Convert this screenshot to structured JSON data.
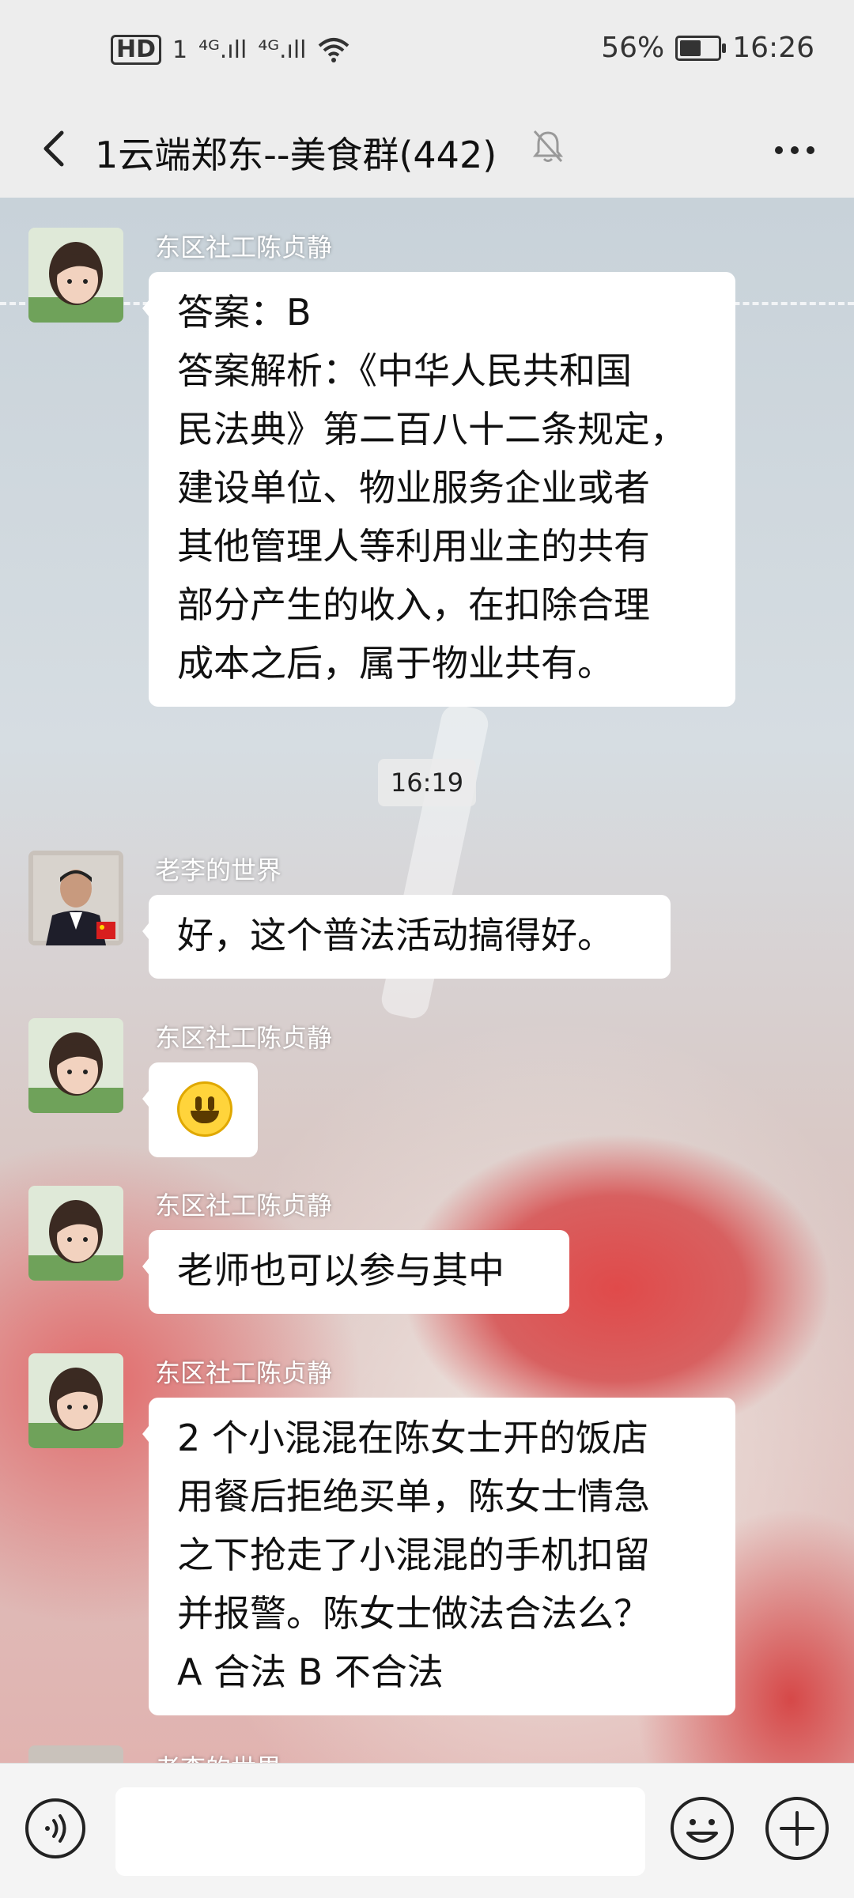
{
  "status_bar": {
    "hd": "HD",
    "sim1": "1",
    "signal1": "⁴ᴳ.ıll",
    "signal2": "⁴ᴳ.ıll",
    "battery_text": "56%",
    "battery_level": 0.56,
    "time": "16:26"
  },
  "header": {
    "title": "1云端郑东--美食群(442)",
    "back_icon": "chevron-left-icon",
    "mute_icon": "bell-muted-icon",
    "more_icon": "more-dots-icon"
  },
  "messages": [
    {
      "sender": "东区社工陈贞静",
      "lines": [
        "答案：B",
        "答案解析：《中华人民共和国",
        "民法典》第二百八十二条规定，",
        "建设单位、物业服务企业或者",
        "其他管理人等利用业主的共有",
        "部分产生的收入，在扣除合理",
        "成本之后，属于物业共有。"
      ]
    },
    {
      "timestamp": "16:19"
    },
    {
      "sender": "老李的世界",
      "lines": [
        "好，这个普法活动搞得好。"
      ]
    },
    {
      "sender": "东区社工陈贞静",
      "emoji": "grinning-face"
    },
    {
      "sender": "东区社工陈贞静",
      "lines": [
        "老师也可以参与其中"
      ]
    },
    {
      "sender": "东区社工陈贞静",
      "lines": [
        "2 个小混混在陈女士开的饭店",
        "用餐后拒绝买单，陈女士情急",
        "之下抢走了小混混的手机扣留",
        "并报警。陈女士做法合法么？",
        "A 合法 B 不合法"
      ]
    },
    {
      "sender": "老李的世界",
      "partial": true
    }
  ],
  "input_bar": {
    "voice_icon": "voice-icon",
    "emoji_icon": "emoji-icon",
    "plus_icon": "plus-icon",
    "field_value": ""
  }
}
